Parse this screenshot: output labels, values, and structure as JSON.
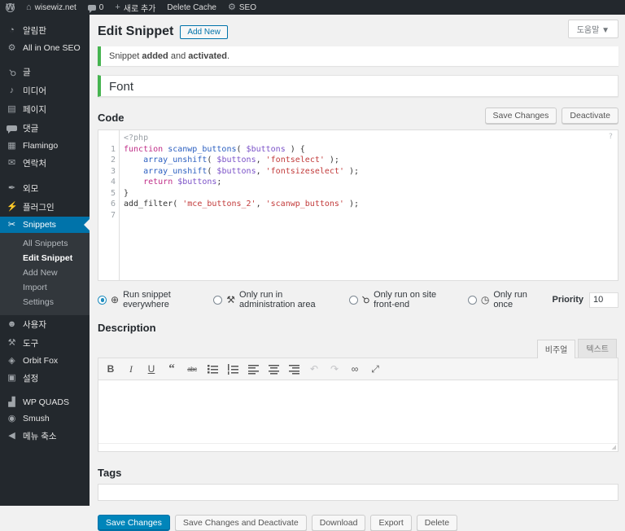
{
  "topbar": {
    "items": [
      {
        "name": "wordpress-menu",
        "icon": "wordpress-logo",
        "label": ""
      },
      {
        "name": "site-name",
        "icon": "home-icon",
        "label": "wisewiz.net"
      },
      {
        "name": "comments-count",
        "icon": "comment-icon",
        "label": "0"
      },
      {
        "name": "new-content",
        "icon": "plus-icon",
        "label": "새로 추가"
      },
      {
        "name": "delete-cache",
        "icon": "",
        "label": "Delete Cache"
      },
      {
        "name": "seo-menu",
        "icon": "gear-icon",
        "label": "SEO"
      }
    ]
  },
  "sidebar": {
    "items": [
      {
        "name": "dashboard",
        "icon": "dashboard-icon",
        "label": "알림판"
      },
      {
        "name": "all-in-one-seo",
        "icon": "seo-gear-icon",
        "label": "All in One SEO"
      },
      {
        "sep": true
      },
      {
        "name": "posts",
        "icon": "pin-icon",
        "label": "글"
      },
      {
        "name": "media",
        "icon": "media-icon",
        "label": "미디어"
      },
      {
        "name": "pages",
        "icon": "pages-icon",
        "label": "페이지"
      },
      {
        "name": "comments",
        "icon": "comments-icon",
        "label": "댓글"
      },
      {
        "name": "flamingo",
        "icon": "flamingo-icon",
        "label": "Flamingo"
      },
      {
        "name": "contact",
        "icon": "mail-icon",
        "label": "연락처"
      },
      {
        "sep": true
      },
      {
        "name": "appearance",
        "icon": "appearance-icon",
        "label": "외모"
      },
      {
        "name": "plugins",
        "icon": "plugins-icon",
        "label": "플러그인"
      },
      {
        "name": "snippets",
        "icon": "scissors-icon",
        "label": "Snippets",
        "active": true,
        "submenu": [
          {
            "name": "all-snippets",
            "label": "All Snippets"
          },
          {
            "name": "edit-snippet",
            "label": "Edit Snippet",
            "current": true
          },
          {
            "name": "add-new",
            "label": "Add New"
          },
          {
            "name": "import",
            "label": "Import"
          },
          {
            "name": "settings",
            "label": "Settings"
          }
        ]
      },
      {
        "name": "users",
        "icon": "users-icon",
        "label": "사용자"
      },
      {
        "name": "tools",
        "icon": "tools-icon",
        "label": "도구"
      },
      {
        "name": "orbit-fox",
        "icon": "orbitfox-icon",
        "label": "Orbit Fox"
      },
      {
        "name": "settings-general",
        "icon": "settings-icon",
        "label": "설정"
      },
      {
        "sep": true
      },
      {
        "name": "wp-quads",
        "icon": "chart-icon",
        "label": "WP QUADS"
      },
      {
        "name": "smush",
        "icon": "smush-icon",
        "label": "Smush"
      },
      {
        "name": "collapse-menu",
        "icon": "collapse-icon",
        "label": "메뉴 축소"
      }
    ]
  },
  "header": {
    "title": "Edit Snippet",
    "add_new": "Add New",
    "help": "도움말 ▼"
  },
  "notice": {
    "parts": [
      "Snippet ",
      "added",
      " and ",
      "activated",
      "."
    ]
  },
  "title_field": {
    "value": "Font"
  },
  "code_section": {
    "heading": "Code",
    "save_button": "Save Changes",
    "deactivate_button": "Deactivate",
    "editor": {
      "help": "?",
      "meta_line": "<?php",
      "lines": [
        {
          "num": "1",
          "tokens": [
            [
              "kw",
              "function"
            ],
            [
              "pl",
              " "
            ],
            [
              "fn",
              "scanwp_buttons"
            ],
            [
              "pl",
              "( "
            ],
            [
              "var",
              "$buttons"
            ],
            [
              "pl",
              " ) {"
            ]
          ]
        },
        {
          "num": "2",
          "tokens": [
            [
              "pl",
              "    "
            ],
            [
              "fn",
              "array_unshift"
            ],
            [
              "pl",
              "( "
            ],
            [
              "var",
              "$buttons"
            ],
            [
              "pl",
              ", "
            ],
            [
              "str",
              "'fontselect'"
            ],
            [
              "pl",
              " );"
            ]
          ]
        },
        {
          "num": "3",
          "tokens": [
            [
              "pl",
              "    "
            ],
            [
              "fn",
              "array_unshift"
            ],
            [
              "pl",
              "( "
            ],
            [
              "var",
              "$buttons"
            ],
            [
              "pl",
              ", "
            ],
            [
              "str",
              "'fontsizeselect'"
            ],
            [
              "pl",
              " );"
            ]
          ]
        },
        {
          "num": "4",
          "tokens": [
            [
              "pl",
              "    "
            ],
            [
              "kw",
              "return"
            ],
            [
              "pl",
              " "
            ],
            [
              "var",
              "$buttons"
            ],
            [
              "pl",
              ";"
            ]
          ]
        },
        {
          "num": "5",
          "tokens": [
            [
              "pl",
              "}"
            ]
          ]
        },
        {
          "num": "6",
          "tokens": [
            [
              "pl",
              "add_filter"
            ],
            [
              "pl",
              "( "
            ],
            [
              "str",
              "'mce_buttons_2'"
            ],
            [
              "pl",
              ", "
            ],
            [
              "str",
              "'scanwp_buttons'"
            ],
            [
              "pl",
              " );"
            ]
          ]
        },
        {
          "num": "7",
          "tokens": []
        }
      ]
    }
  },
  "scope": {
    "options": [
      {
        "name": "run-everywhere",
        "icon": "globe-icon",
        "label": "Run snippet everywhere",
        "selected": true
      },
      {
        "name": "run-admin-only",
        "icon": "wrench-icon",
        "label": "Only run in administration area",
        "selected": false
      },
      {
        "name": "run-frontend-only",
        "icon": "pushpin-icon",
        "label": "Only run on site front-end",
        "selected": false
      },
      {
        "name": "run-once",
        "icon": "clock-icon",
        "label": "Only run once",
        "selected": false
      }
    ],
    "priority_label": "Priority",
    "priority_value": "10"
  },
  "description": {
    "heading": "Description",
    "tabs": [
      {
        "name": "tab-visual",
        "label": "비주얼",
        "active": true
      },
      {
        "name": "tab-text",
        "label": "텍스트",
        "active": false
      }
    ],
    "toolbar": [
      {
        "name": "bold-icon"
      },
      {
        "name": "italic-icon"
      },
      {
        "name": "underline-icon"
      },
      {
        "name": "blockquote-icon"
      },
      {
        "name": "strikethrough-icon"
      },
      {
        "name": "bullet-list-icon"
      },
      {
        "name": "numbered-list-icon"
      },
      {
        "name": "align-left-icon"
      },
      {
        "name": "align-center-icon"
      },
      {
        "name": "align-right-icon"
      },
      {
        "name": "undo-icon"
      },
      {
        "name": "redo-icon"
      },
      {
        "name": "link-icon"
      },
      {
        "name": "fullscreen-icon"
      }
    ],
    "content": ""
  },
  "tags": {
    "heading": "Tags",
    "value": ""
  },
  "footer_buttons": [
    {
      "name": "save-changes-button",
      "label": "Save Changes",
      "primary": true
    },
    {
      "name": "save-deactivate-button",
      "label": "Save Changes and Deactivate",
      "primary": false
    },
    {
      "name": "download-button",
      "label": "Download",
      "primary": false
    },
    {
      "name": "export-button",
      "label": "Export",
      "primary": false
    },
    {
      "name": "delete-button",
      "label": "Delete",
      "primary": false
    }
  ],
  "colors": {
    "accent": "#0073aa",
    "success": "#46b450",
    "sidebar_bg": "#23282d",
    "primary_button": "#0085ba"
  }
}
